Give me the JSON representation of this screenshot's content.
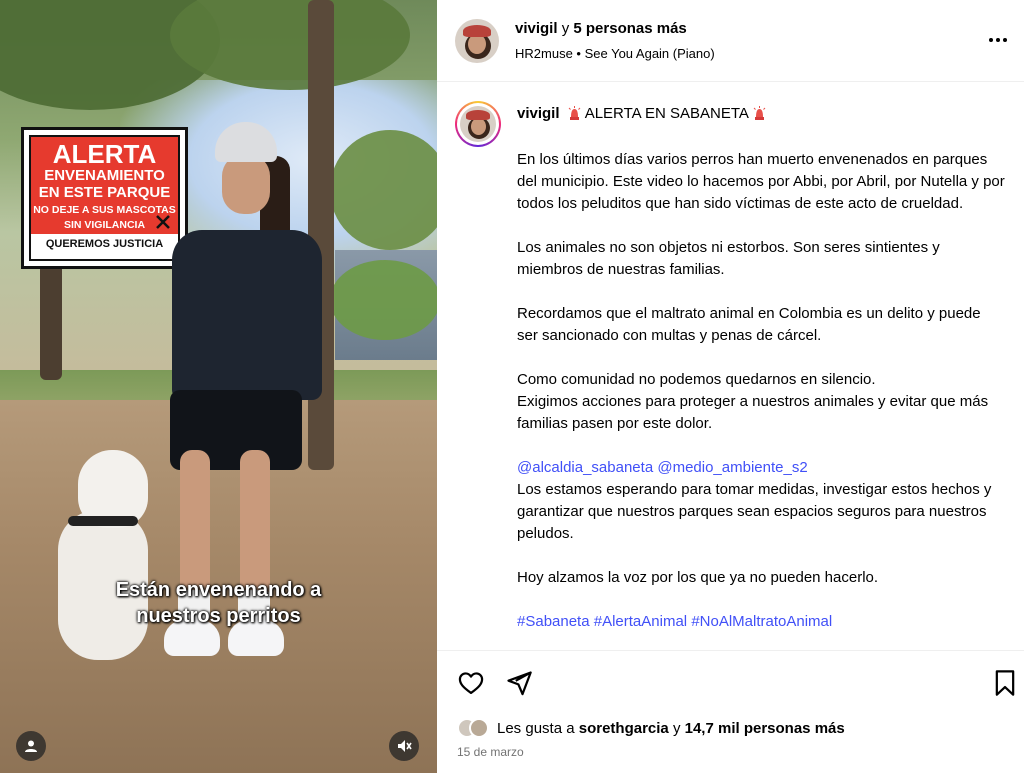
{
  "media": {
    "sign": {
      "title": "ALERTA",
      "line1": "ENVENAMIENTO",
      "line2": "EN ESTE PARQUE",
      "warning1": "NO DEJE A SUS MASCOTAS",
      "warning2": "SIN VIGILANCIA",
      "footer": "QUEREMOS JUSTICIA"
    },
    "caption_line1": "Están envenenando a",
    "caption_line2": "nuestros perritos",
    "user_icon": "user-icon",
    "mute_icon": "speaker-muted-icon"
  },
  "header": {
    "username": "vivigil",
    "connector": " y ",
    "collaborators": "5 personas más",
    "audio_artist": "HR2muse",
    "audio_separator": " • ",
    "audio_title": "See You Again (Piano)",
    "more_icon": "more-options-icon"
  },
  "post": {
    "username": "vivigil",
    "title": "ALERTA EN SABANETA",
    "paragraphs": [
      "En los últimos días varios perros han muerto envenenados en parques del municipio. Este video lo hacemos por Abbi, por Abril, por Nutella y por todos los peluditos que han sido víctimas de este acto de crueldad.",
      "Los animales no son objetos ni estorbos. Son seres sintientes y miembros de nuestras familias.",
      "Recordamos que el maltrato animal en Colombia es un delito y puede ser sancionado con multas y penas de cárcel."
    ],
    "community_line1": "Como comunidad no podemos quedarnos en silencio.",
    "community_line2": "Exigimos acciones para proteger a nuestros animales y evitar que más familias pasen por este dolor.",
    "mention1": "@alcaldia_sabaneta",
    "mention2": "@medio_ambiente_s2",
    "mention_text": "Los estamos esperando para tomar medidas, investigar estos hechos y garantizar que nuestros parques sean espacios seguros para nuestros peludos.",
    "closing": "Hoy alzamos la voz por los que ya no pueden hacerlo.",
    "hashtags": [
      "#Sabaneta",
      "#AlertaAnimal",
      "#NoAlMaltratoAnimal"
    ]
  },
  "actions": {
    "like_icon": "heart-icon",
    "share_icon": "send-icon",
    "save_icon": "bookmark-icon"
  },
  "likes": {
    "prefix": "Les gusta a ",
    "user": "sorethgarcia",
    "connector": " y ",
    "count": "14,7 mil personas más"
  },
  "date": "15 de marzo",
  "colors": {
    "hashtag": "#4150f7",
    "mention": "#00376b",
    "date": "#737373",
    "sign_red": "#e63a2e"
  }
}
